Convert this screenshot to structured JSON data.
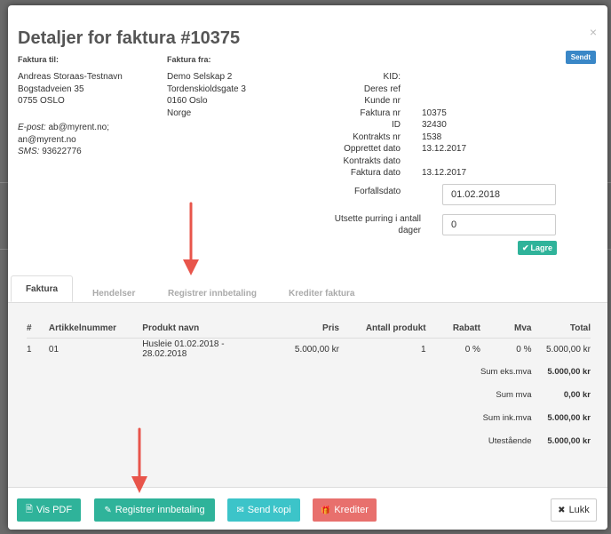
{
  "modal": {
    "title": "Detaljer for faktura #10375",
    "status_badge": "Sendt",
    "close": "×"
  },
  "invoice_to": {
    "header": "Faktura til:",
    "lines": [
      "Andreas Storaas-Testnavn",
      "Bogstadveien 35",
      "0755 OSLO"
    ],
    "email_label": "E-post:",
    "email_value": "ab@myrent.no;",
    "email_value2": "an@myrent.no",
    "sms_label": "SMS:",
    "sms_value": "93622776"
  },
  "invoice_from": {
    "header": "Faktura fra:",
    "lines": [
      "Demo Selskap 2",
      "Tordenskioldsgate 3",
      "0160 Oslo",
      "Norge"
    ]
  },
  "details": [
    {
      "label": "KID:",
      "value": ""
    },
    {
      "label": "Deres ref",
      "value": ""
    },
    {
      "label": "Kunde nr",
      "value": ""
    },
    {
      "label": "Faktura nr",
      "value": "10375"
    },
    {
      "label": "ID",
      "value": "32430"
    },
    {
      "label": "Kontrakts nr",
      "value": "1538"
    },
    {
      "label": "Opprettet dato",
      "value": "13.12.2017"
    },
    {
      "label": "Kontrakts dato",
      "value": ""
    },
    {
      "label": "Faktura dato",
      "value": "13.12.2017"
    }
  ],
  "due_date": {
    "label": "Forfallsdato",
    "value": "01.02.2018"
  },
  "postpone": {
    "label_line1": "Utsette purring i antall",
    "label_line2": "dager",
    "value": "0"
  },
  "save_label": "Lagre",
  "tabs": [
    "Faktura",
    "Hendelser",
    "Registrer innbetaling",
    "Krediter faktura"
  ],
  "table": {
    "headers": [
      "#",
      "Artikkelnummer",
      "Produkt navn",
      "Pris",
      "Antall produkt",
      "Rabatt",
      "Mva",
      "Total"
    ],
    "rows": [
      [
        "1",
        "01",
        "Husleie 01.02.2018 - 28.02.2018",
        "5.000,00 kr",
        "1",
        "0 %",
        "0 %",
        "5.000,00 kr"
      ]
    ],
    "summary": [
      {
        "label": "Sum eks.mva",
        "value": "5.000,00 kr"
      },
      {
        "label": "Sum mva",
        "value": "0,00 kr"
      },
      {
        "label": "Sum ink.mva",
        "value": "5.000,00 kr"
      },
      {
        "label": "Utestående",
        "value": "5.000,00 kr"
      }
    ]
  },
  "footer": {
    "pdf": "Vis PDF",
    "register": "Registrer innbetaling",
    "send_copy": "Send kopi",
    "credit": "Krediter",
    "close": "Lukk"
  },
  "colors": {
    "primary": "#2fb39a",
    "danger": "#e8706d",
    "info": "#3cc4c9",
    "badge": "#3a87c7",
    "arrow": "#e8554b"
  }
}
